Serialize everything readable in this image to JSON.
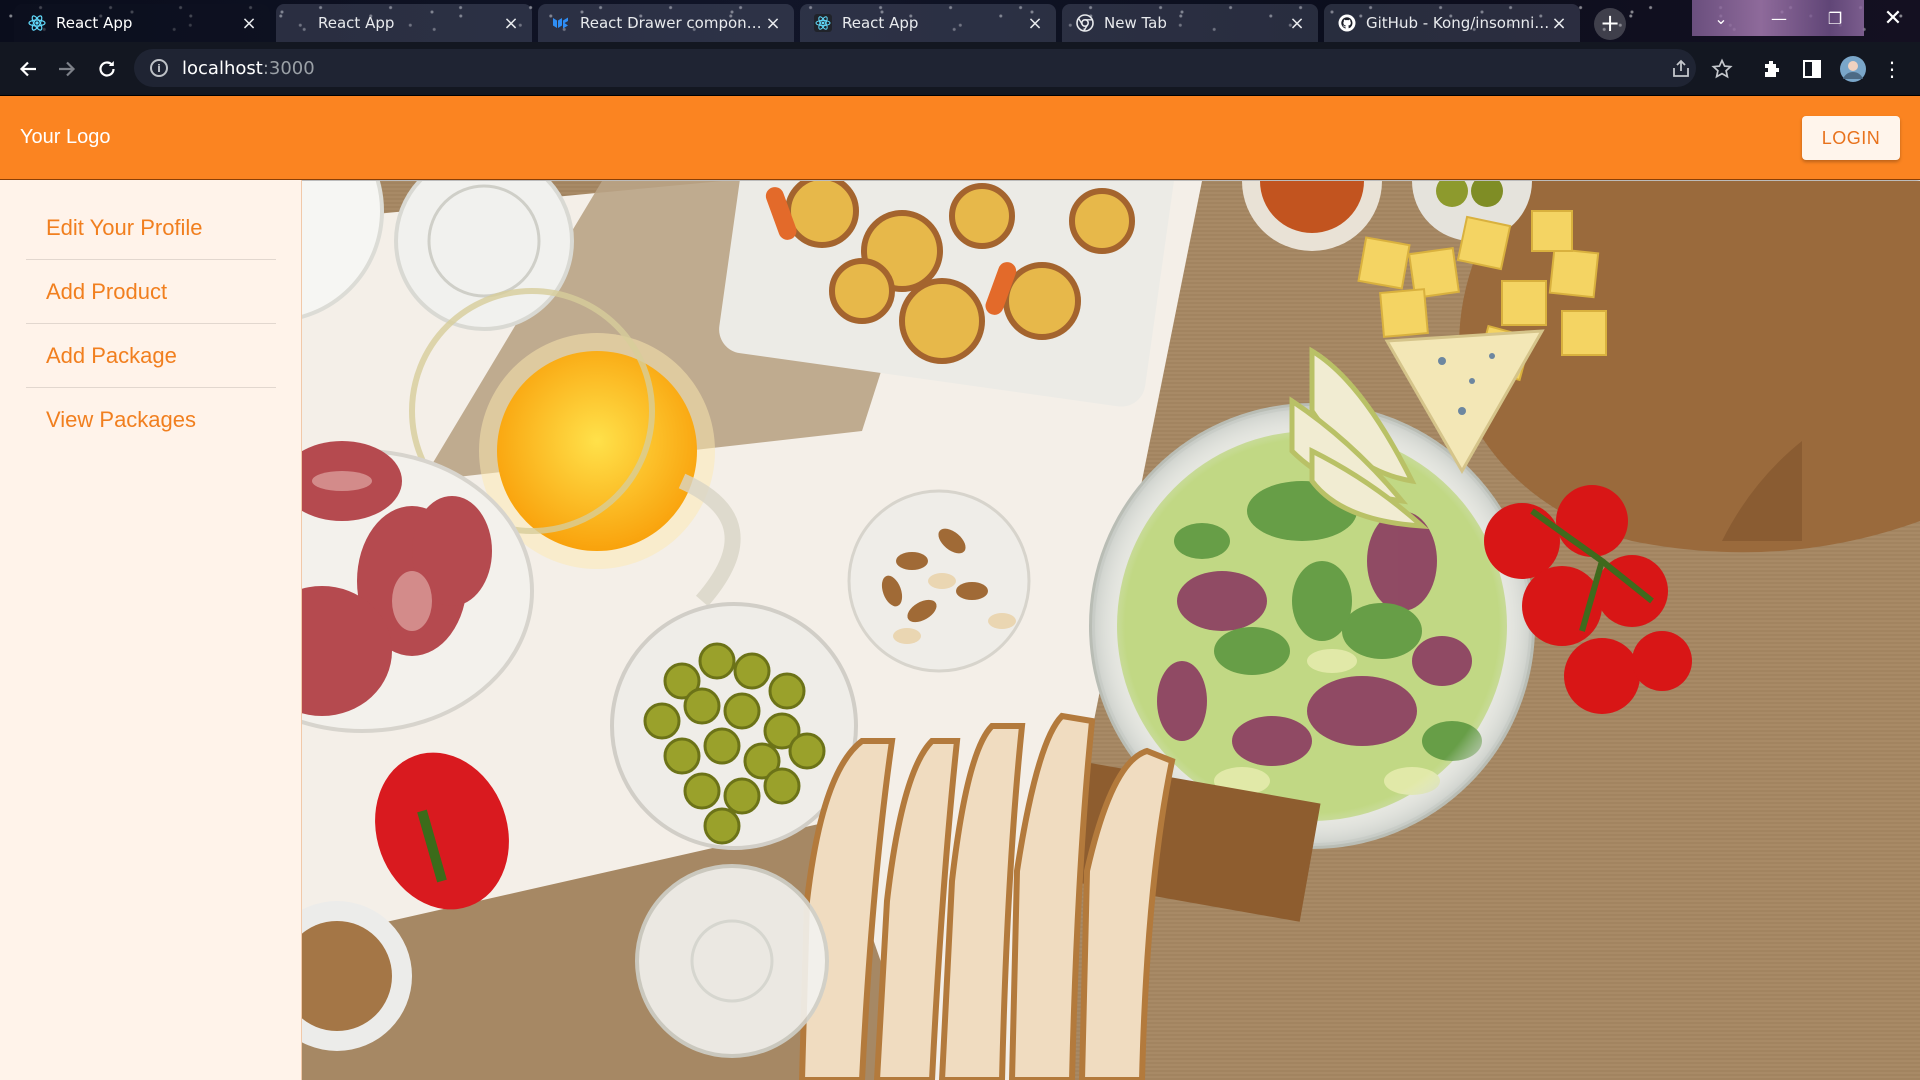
{
  "browser": {
    "tabs": [
      {
        "title": "React App",
        "icon": "react-icon",
        "active": true
      },
      {
        "title": "React App",
        "icon": "none",
        "active": false
      },
      {
        "title": "React Drawer component",
        "icon": "mui-icon",
        "active": false
      },
      {
        "title": "React App",
        "icon": "react-icon",
        "active": false
      },
      {
        "title": "New Tab",
        "icon": "chrome-icon",
        "active": false
      },
      {
        "title": "GitHub - Kong/insomnia:...",
        "icon": "github-icon",
        "active": false
      }
    ],
    "address": {
      "host": "localhost",
      "port": ":3000"
    }
  },
  "app": {
    "logo": "Your Logo",
    "login_label": "LOGIN",
    "brand_color": "#fb8421",
    "menu": [
      {
        "label": "Edit Your Profile"
      },
      {
        "label": "Add Product"
      },
      {
        "label": "Add Package"
      },
      {
        "label": "View Packages"
      }
    ],
    "hero_image": "food-table-photo"
  }
}
